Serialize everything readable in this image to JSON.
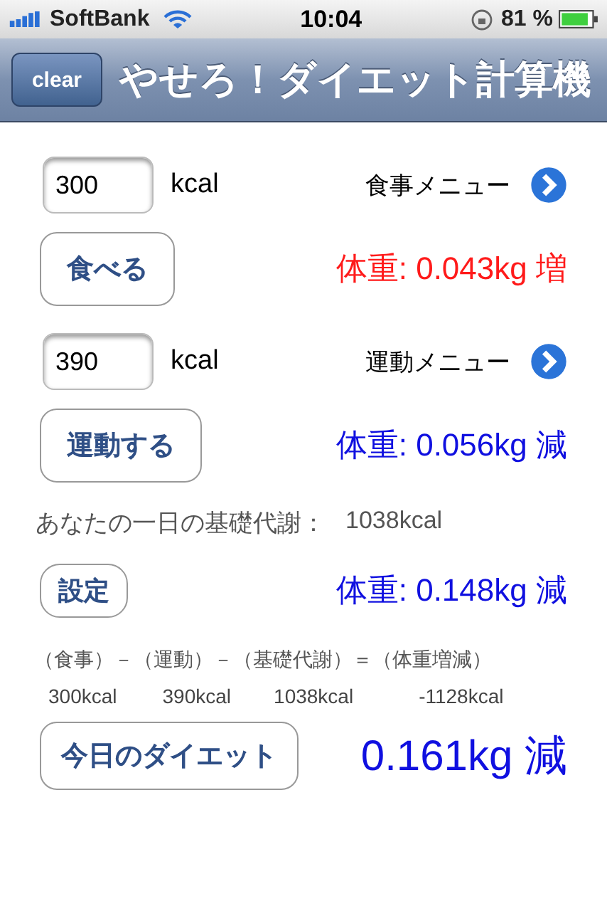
{
  "status_bar": {
    "carrier": "SoftBank",
    "time": "10:04",
    "battery": "81 %"
  },
  "nav_bar": {
    "left_button": "clear",
    "title": "やせろ！ダイエット計算機"
  },
  "meal": {
    "value": "300",
    "unit": "kcal",
    "menu": "食事メニュー",
    "button": "食べる",
    "result": {
      "text": "体重: 0.043kg 増",
      "kind": "gain"
    }
  },
  "exercise": {
    "value": "390",
    "unit": "kcal",
    "menu": "運動メニュー",
    "button": "運動する",
    "result": {
      "text": "体重: 0.056kg 減",
      "kind": "loss"
    }
  },
  "bmr": {
    "label": "あなたの一日の基礎代謝：",
    "value": "1038kcal"
  },
  "settings": {
    "button": "設定",
    "result": {
      "text": "体重: 0.148kg 減",
      "kind": "loss"
    }
  },
  "formula": {
    "equation": "（食事）－（運動）－（基礎代謝）＝（体重増減）",
    "values": [
      "300kcal",
      "390kcal",
      "1038kcal",
      "-1128kcal"
    ]
  },
  "today": {
    "button": "今日のダイエット",
    "result": {
      "text": "0.161kg 減",
      "kind": "loss"
    }
  }
}
